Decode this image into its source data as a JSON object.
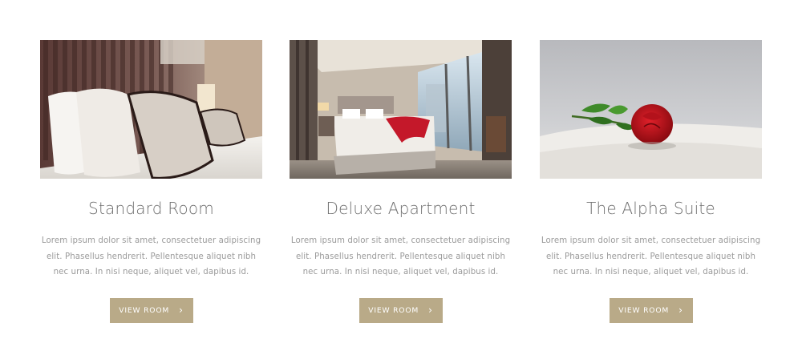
{
  "rooms": [
    {
      "title": "Standard Room",
      "description": "Lorem ipsum dolor sit amet, consectetuer adipiscing elit. Phasellus hendrerit. Pellentesque aliquet nibh nec urna. In nisi neque, aliquet vel, dapibus id.",
      "button_label": "VIEW ROOM",
      "button_icon": "chevron-right-icon",
      "photo": "bedroom-pillows-photo"
    },
    {
      "title": "Deluxe Apartment",
      "description": "Lorem ipsum dolor sit amet, consectetuer adipiscing elit. Phasellus hendrerit. Pellentesque aliquet nibh nec urna. In nisi neque, aliquet vel, dapibus id.",
      "button_label": "VIEW ROOM",
      "button_icon": "chevron-right-icon",
      "photo": "apartment-bedroom-photo"
    },
    {
      "title": "The Alpha Suite",
      "description": "Lorem ipsum dolor sit amet, consectetuer adipiscing elit. Phasellus hendrerit. Pellentesque aliquet nibh nec urna. In nisi neque, aliquet vel, dapibus id.",
      "button_label": "VIEW ROOM",
      "button_icon": "chevron-right-icon",
      "photo": "red-rose-on-bed-photo"
    }
  ],
  "colors": {
    "button_bg": "#b9aa88",
    "title_text": "#6f6f6f",
    "body_text": "#9a9a9a"
  }
}
